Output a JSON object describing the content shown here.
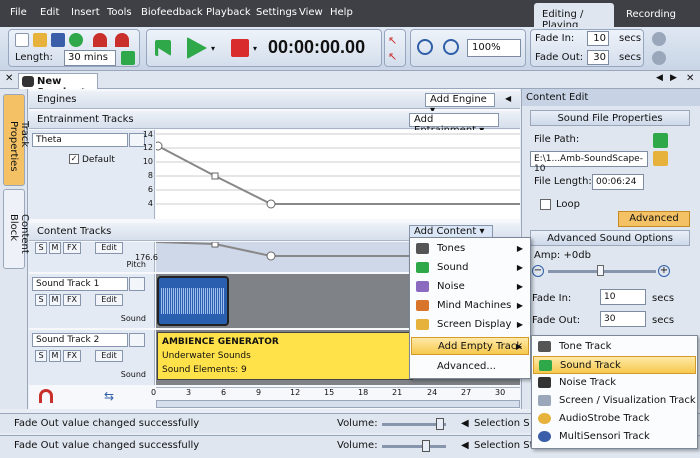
{
  "menu": [
    "File",
    "Edit",
    "Insert",
    "Tools",
    "Biofeedback",
    "Playback",
    "Settings",
    "View",
    "Help"
  ],
  "mode_tabs": {
    "active": "Editing / Playing",
    "inactive": "Recording"
  },
  "toolbar": {
    "length_label": "Length:",
    "length_value": "30 mins",
    "timer": "00:00:00.00",
    "zoom": "100%",
    "fade_in_label": "Fade In:",
    "fade_in_value": "10",
    "fade_out_label": "Fade Out:",
    "fade_out_value": "30",
    "unit": "secs"
  },
  "session_tab": "New Session*",
  "vertical_tabs": [
    "Track Properties",
    "Content Block"
  ],
  "engines": {
    "title": "Engines",
    "button": "Add Engine"
  },
  "entrainment": {
    "title": "Entrainment Tracks",
    "button": "Add Entrainment",
    "track_name": "Theta",
    "default_label": "Default",
    "y_ticks": [
      "14",
      "12",
      "10",
      "8",
      "6",
      "4"
    ]
  },
  "content": {
    "title": "Content Tracks",
    "button": "Add Content",
    "pitch_label": "Pitch",
    "pitch_value": "176.6",
    "s_label": "S",
    "m_label": "M",
    "fx_label": "FX",
    "edit_label": "Edit",
    "tracks": [
      {
        "name": "Sound Track 1",
        "type": "Sound"
      },
      {
        "name": "Sound Track 2",
        "type": "Sound"
      }
    ],
    "ambience": {
      "title": "AMBIENCE GENERATOR",
      "line1": "Underwater Sounds",
      "line2": "Sound Elements: 9"
    }
  },
  "ruler_ticks": [
    "0",
    "3",
    "6",
    "9",
    "12",
    "15",
    "18",
    "21",
    "24",
    "27",
    "30"
  ],
  "right_panel": {
    "title": "Content Edit",
    "section1": "Sound File Properties",
    "file_path_label": "File Path:",
    "file_path_value": "E:\\1...Amb-SoundScape-10",
    "file_length_label": "File Length:",
    "file_length_value": "00:06:24",
    "loop_label": "Loop",
    "advanced_button": "Advanced",
    "section2": "Advanced Sound Options",
    "amp_label": "Amp: +0db",
    "fade_in_label": "Fade In:",
    "fade_in_value": "10",
    "fade_out_label": "Fade Out:",
    "fade_out_value": "30",
    "unit": "secs"
  },
  "status": {
    "message": "Fade Out value changed successfully",
    "volume_label": "Volume:",
    "selection_label_1": "Selection S",
    "selection_label_2": "Selection Start"
  },
  "context_menu": [
    {
      "label": "Tones",
      "submenu": true
    },
    {
      "label": "Sound",
      "submenu": true
    },
    {
      "label": "Noise",
      "submenu": true
    },
    {
      "label": "Mind Machines",
      "submenu": true
    },
    {
      "label": "Screen Display",
      "submenu": true
    },
    {
      "label": "Add Empty Track",
      "submenu": true,
      "highlighted": true
    },
    {
      "label": "Advanced...",
      "submenu": false
    }
  ],
  "submenu": [
    {
      "label": "Tone Track"
    },
    {
      "label": "Sound Track",
      "highlighted": true
    },
    {
      "label": "Noise Track"
    },
    {
      "label": "Screen / Visualization Track"
    },
    {
      "label": "AudioStrobe Track"
    },
    {
      "label": "MultiSensori Track"
    }
  ],
  "colors": {
    "menubar": "#3f4045",
    "ambience_block": "#ffe24a",
    "highlight": "#f6c94d",
    "play_green": "#2fa84a",
    "stop_red": "#d92b2b"
  }
}
